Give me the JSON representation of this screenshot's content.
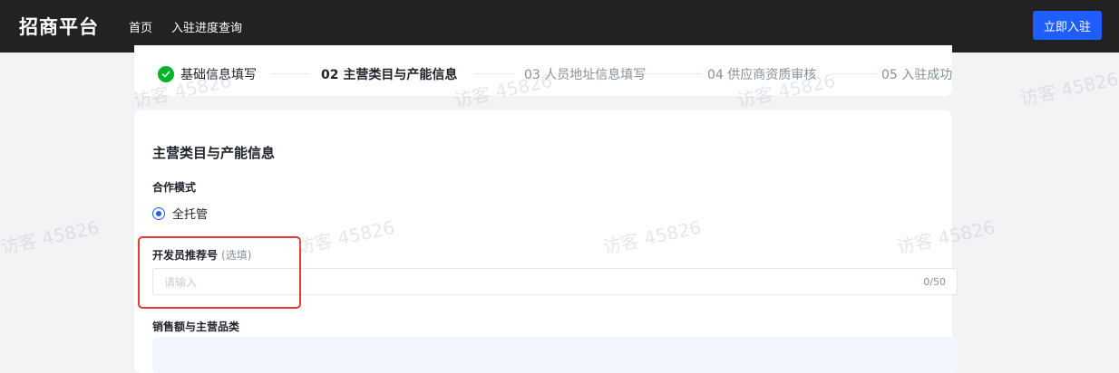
{
  "header": {
    "logo": "招商平台",
    "nav": [
      "首页",
      "入驻进度查询"
    ],
    "join_button": "立即入驻"
  },
  "steps": [
    {
      "label": "基础信息填写",
      "state": "done"
    },
    {
      "label": "02 主营类目与产能信息",
      "state": "active"
    },
    {
      "label": "03 人员地址信息填写",
      "state": "todo"
    },
    {
      "label": "04 供应商资质审核",
      "state": "todo"
    },
    {
      "label": "05 入驻成功",
      "state": "todo"
    }
  ],
  "form": {
    "section_title": "主营类目与产能信息",
    "cooperation_label": "合作模式",
    "cooperation_option": "全托管",
    "referral_label": "开发员推荐号",
    "referral_optional": "(选填)",
    "referral_placeholder": "请输入",
    "referral_counter": "0/50",
    "sales_label": "销售额与主营品类"
  },
  "watermark": "访客 45826",
  "colors": {
    "accent": "#1e5eff",
    "success": "#00b42a",
    "highlight": "#e53935",
    "topbar": "#222222"
  }
}
